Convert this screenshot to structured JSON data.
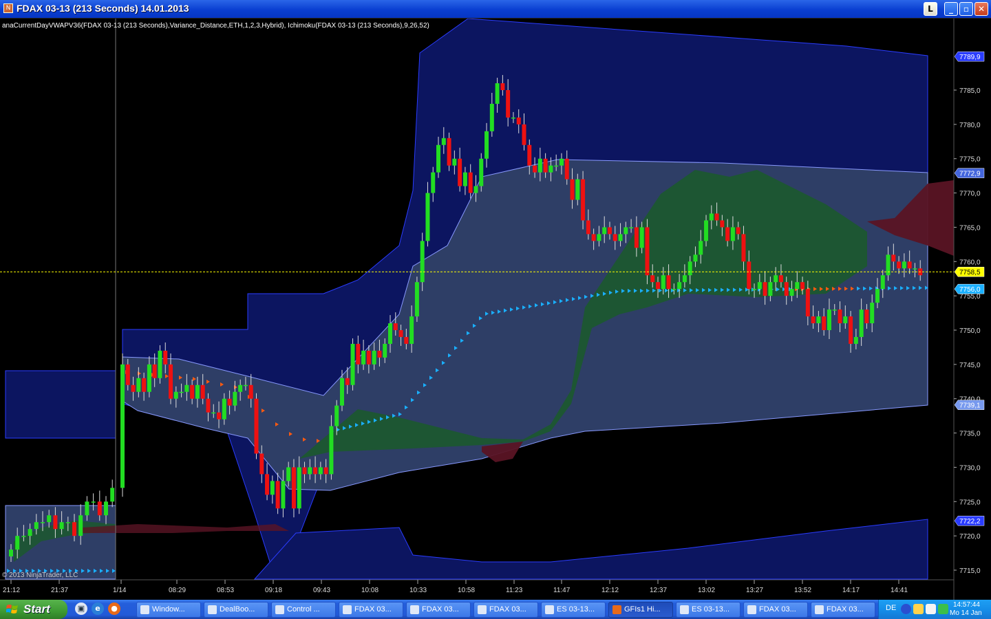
{
  "window": {
    "title": "FDAX 03-13 (213 Seconds)  14.01.2013",
    "buttons": {
      "link": "L",
      "minimize": "_",
      "maximize": "▫",
      "close": "✕"
    }
  },
  "chart": {
    "indicator_label": "anaCurrentDayVWAPV36(FDAX 03-13 (213 Seconds),Variance_Distance,ETH,1,2,3,Hybrid),  Ichimoku(FDAX 03-13 (213 Seconds),9,26,52)",
    "copyright": "© 2013 NinjaTrader, LLC",
    "colors": {
      "up": "#22dd22",
      "down": "#ee1111",
      "band_outer": "#0c1560",
      "band_inner": "#2e3e66",
      "cloud_green": "#1a5a2a",
      "cloud_red": "#5a1424",
      "price_line": "#ffff00",
      "vwap_blue": "#1ab0ff",
      "vwap_orange": "#ff5a10"
    }
  },
  "chart_data": {
    "type": "candlestick",
    "instrument": "FDAX 03-13",
    "interval": "213 Seconds",
    "date": "14.01.2013",
    "ylim": [
      7712,
      7795
    ],
    "y_ticks": [
      "7785,0",
      "7780,0",
      "7775,0",
      "7770,0",
      "7765,0",
      "7760,0",
      "7755,0",
      "7750,0",
      "7745,0",
      "7740,0",
      "7735,0",
      "7730,0",
      "7725,0",
      "7720,0",
      "7715,0"
    ],
    "x_ticks": [
      "21:12",
      "21:37",
      "1/14",
      "08:29",
      "08:53",
      "09:18",
      "09:43",
      "10:08",
      "10:33",
      "10:58",
      "11:23",
      "11:47",
      "12:12",
      "12:37",
      "13:02",
      "13:27",
      "13:52",
      "14:17",
      "14:41"
    ],
    "price_markers": [
      {
        "label": "7789,9",
        "value": 7789.9,
        "color": "#2a3cff"
      },
      {
        "label": "7772,9",
        "value": 7772.9,
        "color": "#4466dd"
      },
      {
        "label": "7758,5",
        "value": 7758.5,
        "color": "#ffff00"
      },
      {
        "label": "7756,0",
        "value": 7756.0,
        "color": "#1ab0ff"
      },
      {
        "label": "7739,1",
        "value": 7739.1,
        "color": "#7799ee"
      },
      {
        "label": "7722,2",
        "value": 7722.2,
        "color": "#2a3cff"
      }
    ],
    "current_price": 7758.5,
    "candles_close": [
      7718,
      7720,
      7720,
      7721,
      7722,
      7722,
      7723,
      7721,
      7722,
      7722,
      7720,
      7723,
      7725,
      7725,
      7723,
      7725,
      7727,
      7745,
      7742,
      7741,
      7743,
      7741,
      7745,
      7743,
      7747,
      7745,
      7740,
      7741,
      7741,
      7742,
      7740,
      7742,
      7740,
      7738,
      7738,
      7737,
      7740,
      7739,
      7741,
      7742,
      7742,
      7740,
      7732,
      7729,
      7726,
      7728,
      7724,
      7728,
      7730,
      7724,
      7730,
      7729,
      7730,
      7729,
      7730,
      7729,
      7736,
      7739,
      7743,
      7742,
      7748,
      7745,
      7747,
      7745,
      7747,
      7746,
      7748,
      7751,
      7750,
      7749,
      7748,
      7752,
      7757,
      7763,
      7770,
      7773,
      7777,
      7778,
      7774,
      7775,
      7771,
      7773,
      7770,
      7771,
      7775,
      7779,
      7783,
      7786,
      7785,
      7781,
      7781,
      7780,
      7777,
      7774,
      7773,
      7775,
      7773,
      7774,
      7774,
      7775,
      7772,
      7769,
      7772,
      7766,
      7764,
      7763,
      7764,
      7765,
      7764,
      7763,
      7764,
      7765,
      7765,
      7762,
      7765,
      7758,
      7757,
      7756,
      7758,
      7756,
      7756,
      7757,
      7758,
      7760,
      7761,
      7763,
      7766,
      7767,
      7766,
      7765,
      7763,
      7765,
      7764,
      7760,
      7756,
      7756,
      7757,
      7755,
      7757,
      7758,
      7757,
      7755,
      7756,
      7757,
      7756,
      7752,
      7751,
      7752,
      7750,
      7753,
      7753,
      7751,
      7752,
      7748,
      7749,
      7753,
      7751,
      7754,
      7756,
      7758,
      7761,
      7760,
      7759,
      7760,
      7759,
      7759,
      7758
    ]
  },
  "taskbar": {
    "start_label": "Start",
    "tasks": [
      {
        "label": "Window..."
      },
      {
        "label": "DealBoo..."
      },
      {
        "label": "Control ..."
      },
      {
        "label": "FDAX 03..."
      },
      {
        "label": "FDAX 03..."
      },
      {
        "label": "FDAX 03..."
      },
      {
        "label": "ES 03-13..."
      },
      {
        "label": "GFIs1 Hi..."
      },
      {
        "label": "ES 03-13..."
      },
      {
        "label": "FDAX 03..."
      },
      {
        "label": "FDAX 03..."
      }
    ],
    "tray": {
      "language": "DE",
      "time": "14:57:44",
      "date": "Mo 14 Jan"
    }
  }
}
